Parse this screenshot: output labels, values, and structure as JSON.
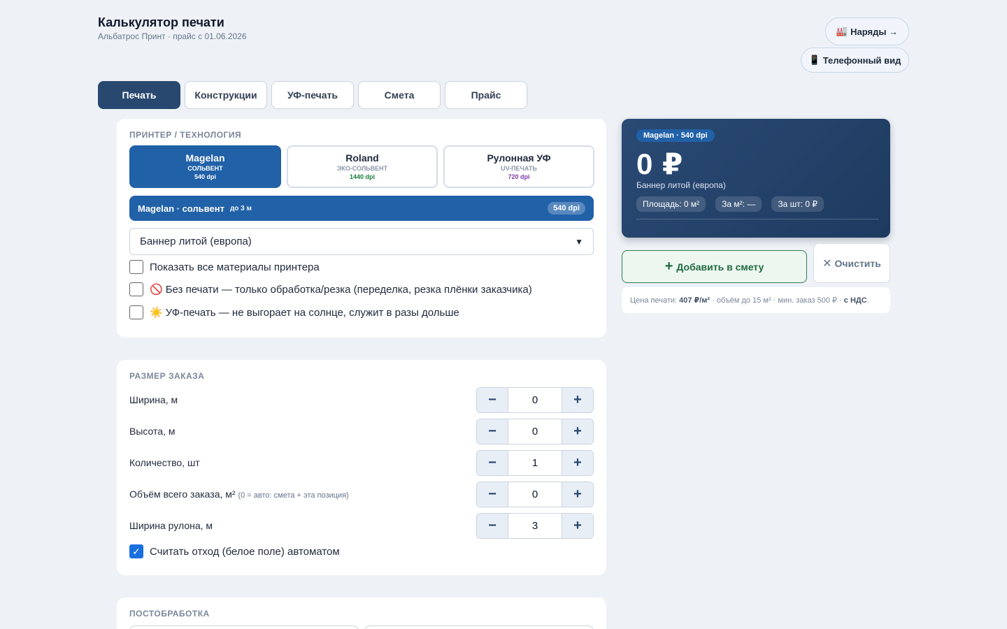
{
  "header": {
    "title": "Калькулятор печати",
    "subtitle": "Альбатрос Принт · прайс с 01.06.2026",
    "orders_icon": "🏭",
    "orders_label": "Наряды →",
    "phone_icon": "📱",
    "phone_label": "Телефонный вид"
  },
  "tabs": [
    {
      "label": "Печать",
      "active": true
    },
    {
      "label": "Конструкции",
      "active": false
    },
    {
      "label": "УФ-печать",
      "active": false
    },
    {
      "label": "Смета",
      "active": false
    },
    {
      "label": "Прайс",
      "active": false
    }
  ],
  "printer_section": {
    "title": "ПРИНТЕР / ТЕХНОЛОГИЯ",
    "printers": [
      {
        "name": "Magelan",
        "tech": "СОЛЬВЕНТ",
        "dpi": "540 dpi",
        "selected": true
      },
      {
        "name": "Roland",
        "tech": "ЭКО-СОЛЬВЕНТ",
        "dpi": "1440 dpi",
        "selected": false
      },
      {
        "name": "Рулонная УФ",
        "tech": "UV-ПЕЧАТЬ",
        "dpi": "720 dpi",
        "selected": false
      }
    ],
    "active_bar": {
      "name": "Magelan · сольвент",
      "width": "до 3 м",
      "dpi": "540 dpi"
    },
    "material": "Баннер литой (европа)",
    "checkboxes": [
      {
        "label": "Показать все материалы принтера",
        "icon": "",
        "checked": false
      },
      {
        "label": "Без печати — только обработка/резка (переделка, резка плёнки заказчика)",
        "icon": "🚫",
        "checked": false
      },
      {
        "label": "УФ-печать — не выгорает на солнце, служит в разы дольше",
        "icon": "☀️",
        "checked": false
      }
    ]
  },
  "size_section": {
    "title": "РАЗМЕР ЗАКАЗА",
    "fields": [
      {
        "label": "Ширина, м",
        "hint": "",
        "value": "0"
      },
      {
        "label": "Высота, м",
        "hint": "",
        "value": "0"
      },
      {
        "label": "Количество, шт",
        "hint": "",
        "value": "1"
      },
      {
        "label": "Объём всего заказа, м²",
        "hint": "(0 = авто: смета + эта позиция)",
        "value": "0"
      },
      {
        "label": "Ширина рулона, м",
        "hint": "",
        "value": "3"
      }
    ],
    "auto_waste": {
      "label": "Считать отход (белое поле) автоматом",
      "checked": true
    }
  },
  "post_section": {
    "title": "ПОСТОБРАБОТКА"
  },
  "price_card": {
    "badge": "Magelan · 540 dpi",
    "amount": "0 ₽",
    "material": "Баннер литой (европа)",
    "stats": [
      "Площадь: 0 м²",
      "За м²: —",
      "За шт: 0 ₽"
    ]
  },
  "actions": {
    "add_label": "Добавить в смету",
    "clear_label": "Очистить"
  },
  "price_note": {
    "prefix": "Цена печати:",
    "rate": "407 ₽/м²",
    "middle": "· объём до 15 м² · мин. заказ 500 ₽ ·",
    "vat": "с НДС",
    "suffix": "."
  },
  "colors": {
    "accent": "#2161a8",
    "tab_active": "#284870",
    "add_green": "#2f7a4f",
    "background": "#eef2f7"
  }
}
